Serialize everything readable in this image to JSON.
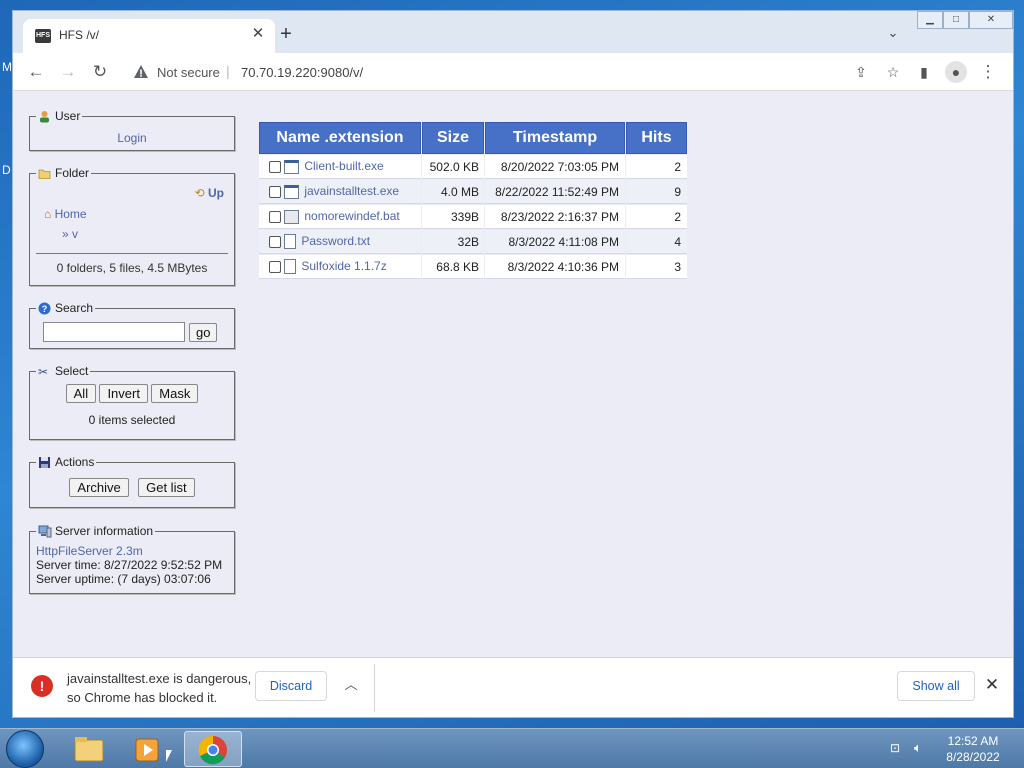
{
  "desktop": {
    "letters": [
      "M",
      "D"
    ]
  },
  "browser": {
    "tab_title": "HFS /v/",
    "favicon_text": "HFS",
    "security_label": "Not secure",
    "url": "70.70.19.220:9080/v/"
  },
  "hfs": {
    "user": {
      "legend": "User",
      "login": "Login"
    },
    "folder": {
      "legend": "Folder",
      "up": "Up",
      "home": "Home",
      "path": "» v",
      "summary": "0 folders, 5 files, 4.5 MBytes"
    },
    "search": {
      "legend": "Search",
      "value": "",
      "go": "go"
    },
    "select": {
      "legend": "Select",
      "all": "All",
      "invert": "Invert",
      "mask": "Mask",
      "status": "0 items selected"
    },
    "actions": {
      "legend": "Actions",
      "archive": "Archive",
      "get_list": "Get list"
    },
    "server": {
      "legend": "Server information",
      "software": "HttpFileServer 2.3m",
      "time": "Server time: 8/27/2022 9:52:52 PM",
      "uptime": "Server uptime: (7 days) 03:07:06"
    },
    "table": {
      "headers": {
        "name": "Name .extension",
        "size": "Size",
        "timestamp": "Timestamp",
        "hits": "Hits"
      },
      "rows": [
        {
          "name": "Client-built.exe",
          "size": "502.0 KB",
          "timestamp": "8/20/2022 7:03:05 PM",
          "hits": "2",
          "icon": "exe-file-icon"
        },
        {
          "name": "javainstalltest.exe",
          "size": "4.0 MB",
          "timestamp": "8/22/2022 11:52:49 PM",
          "hits": "9",
          "icon": "exe-file-icon"
        },
        {
          "name": "nomorewindef.bat",
          "size": "339B",
          "timestamp": "8/23/2022 2:16:37 PM",
          "hits": "2",
          "icon": "bat-file-icon"
        },
        {
          "name": "Password.txt",
          "size": "32B",
          "timestamp": "8/3/2022 4:11:08 PM",
          "hits": "4",
          "icon": "text-file-icon"
        },
        {
          "name": "Sulfoxide 1.1.7z",
          "size": "68.8 KB",
          "timestamp": "8/3/2022 4:10:36 PM",
          "hits": "3",
          "icon": "generic-file-icon"
        }
      ]
    }
  },
  "download_bar": {
    "message_line1": "javainstalltest.exe is dangerous,",
    "message_line2": "so Chrome has blocked it.",
    "discard": "Discard",
    "show_all": "Show all"
  },
  "taskbar": {
    "time": "12:52 AM",
    "date": "8/28/2022"
  },
  "colors": {
    "table_header": "#4771c6",
    "link": "#5066a8",
    "page_bg": "#ececf6",
    "error": "#d93025"
  }
}
